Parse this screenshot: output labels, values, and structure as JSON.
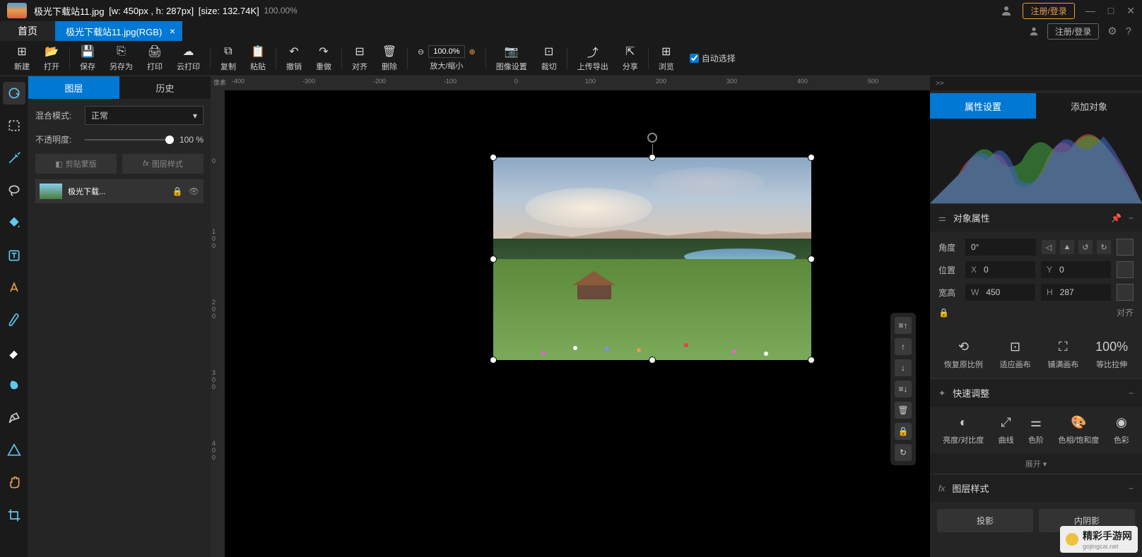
{
  "titlebar": {
    "filename": "极光下载站11.jpg",
    "dimensions": "[w: 450px , h: 287px]",
    "size_label": "[size: 132.74K]",
    "zoom": "100.00%",
    "login": "注册/登录"
  },
  "tabs": {
    "home": "首页",
    "file": "极光下载站11.jpg(RGB)",
    "login": "注册/登录"
  },
  "toolbar": {
    "new": "新建",
    "open": "打开",
    "save": "保存",
    "saveas": "另存为",
    "print": "打印",
    "cloudprint": "云打印",
    "copy": "复制",
    "paste": "粘贴",
    "undo": "撤销",
    "redo": "重做",
    "align": "对齐",
    "delete": "删除",
    "zoom_value": "100.0%",
    "zoom_label": "放大/缩小",
    "imgsettings": "图像设置",
    "crop": "裁切",
    "uploadexport": "上传导出",
    "share": "分享",
    "browse": "浏览",
    "autoselect": "自动选择"
  },
  "ruler": {
    "unit_label": "像素"
  },
  "layers_panel": {
    "tab_layers": "图层",
    "tab_history": "历史",
    "blend_label": "混合模式:",
    "blend_value": "正常",
    "opacity_label": "不透明度:",
    "opacity_value": "100 %",
    "clipmask": "剪贴蒙版",
    "layerstyle": "图层样式",
    "layer_name": "极光下载..."
  },
  "right_panel": {
    "tab_props": "属性设置",
    "tab_addobj": "添加对象",
    "obj_props": "对象属性",
    "angle_label": "角度",
    "angle_value": "0°",
    "pos_label": "位置",
    "pos_x_prefix": "X",
    "pos_x": "0",
    "pos_y_prefix": "Y",
    "pos_y": "0",
    "size_label": "宽高",
    "size_w_prefix": "W",
    "size_w": "450",
    "size_h_prefix": "H",
    "size_h": "287",
    "align_label": "对齐",
    "restore_ratio": "恢复原比例",
    "fit_canvas": "适应画布",
    "fill_canvas": "铺满画布",
    "scale_100": "100%",
    "scale_label": "等比拉伸",
    "quick_adjust": "快速调整",
    "brightness": "亮度/对比度",
    "curves": "曲线",
    "levels": "色阶",
    "hue_sat": "色相/饱和度",
    "color_balance": "色彩",
    "expand": "展开",
    "layer_style": "图层样式",
    "projection": "投影",
    "inner_shadow": "内阴影"
  },
  "watermark": {
    "main": "精彩手游网",
    "sub": "gojingcai.net"
  }
}
